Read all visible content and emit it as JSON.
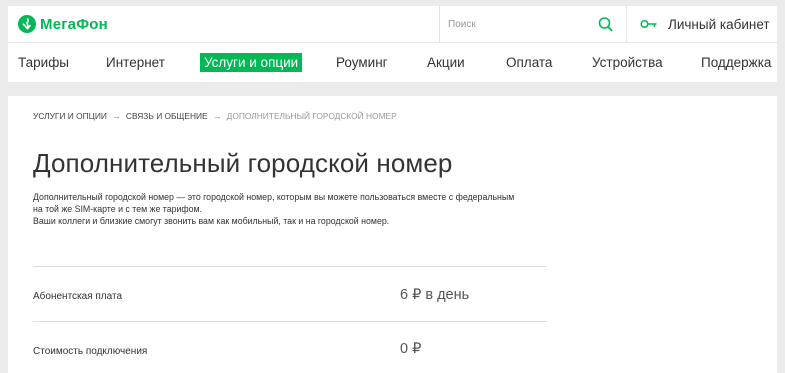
{
  "brand": {
    "name": "МегаФон",
    "color": "#00b956"
  },
  "search": {
    "placeholder": "Поиск",
    "icon": "search-icon"
  },
  "account": {
    "label": "Личный кабинет",
    "icon": "key-icon"
  },
  "nav": {
    "items": [
      {
        "label": "Тарифы",
        "active": false
      },
      {
        "label": "Интернет",
        "active": false
      },
      {
        "label": "Услуги и опции",
        "active": true
      },
      {
        "label": "Роуминг",
        "active": false
      },
      {
        "label": "Акции",
        "active": false
      },
      {
        "label": "Оплата",
        "active": false
      },
      {
        "label": "Устройства",
        "active": false
      },
      {
        "label": "Поддержка",
        "active": false
      }
    ]
  },
  "breadcrumb": {
    "items": [
      "УСЛУГИ И ОПЦИИ",
      "СВЯЗЬ И ОБЩЕНИЕ"
    ],
    "separator": "→",
    "current": "ДОПОЛНИТЕЛЬНЫЙ ГОРОДСКОЙ НОМЕР"
  },
  "page": {
    "title": "Дополнительный городской номер",
    "description": [
      "Дополнительный городской номер — это городской номер, которым вы можете пользоваться вместе с федеральным",
      "на той же SIM-карте и с тем же тарифом.",
      "Ваши коллеги и близкие смогут звонить вам как мобильный, так и на городской номер."
    ]
  },
  "pricing": {
    "rows": [
      {
        "label": "Абонентская плата",
        "value": "6 ₽ в день"
      },
      {
        "label": "Стоимость подключения",
        "value": "0 ₽"
      }
    ]
  }
}
